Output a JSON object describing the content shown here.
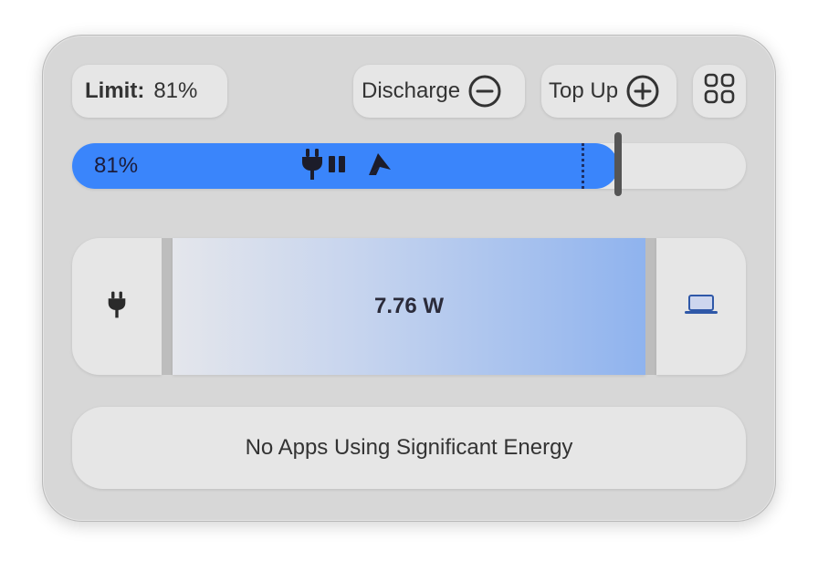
{
  "limit": {
    "label": "Limit:",
    "value": "81%"
  },
  "buttons": {
    "discharge_label": "Discharge",
    "topup_label": "Top Up"
  },
  "charge_bar": {
    "percent_text": "81%",
    "charge_fraction": 0.81,
    "limit_fraction": 0.81,
    "accent_color": "#3a85fb",
    "icons": [
      "plug-icon",
      "pause-icon",
      "sailing-icon"
    ]
  },
  "power_flow": {
    "source_icon": "plug-icon",
    "wattage": "7.76 W",
    "target_icon": "laptop-icon"
  },
  "apps": {
    "message": "No Apps Using Significant Energy"
  }
}
